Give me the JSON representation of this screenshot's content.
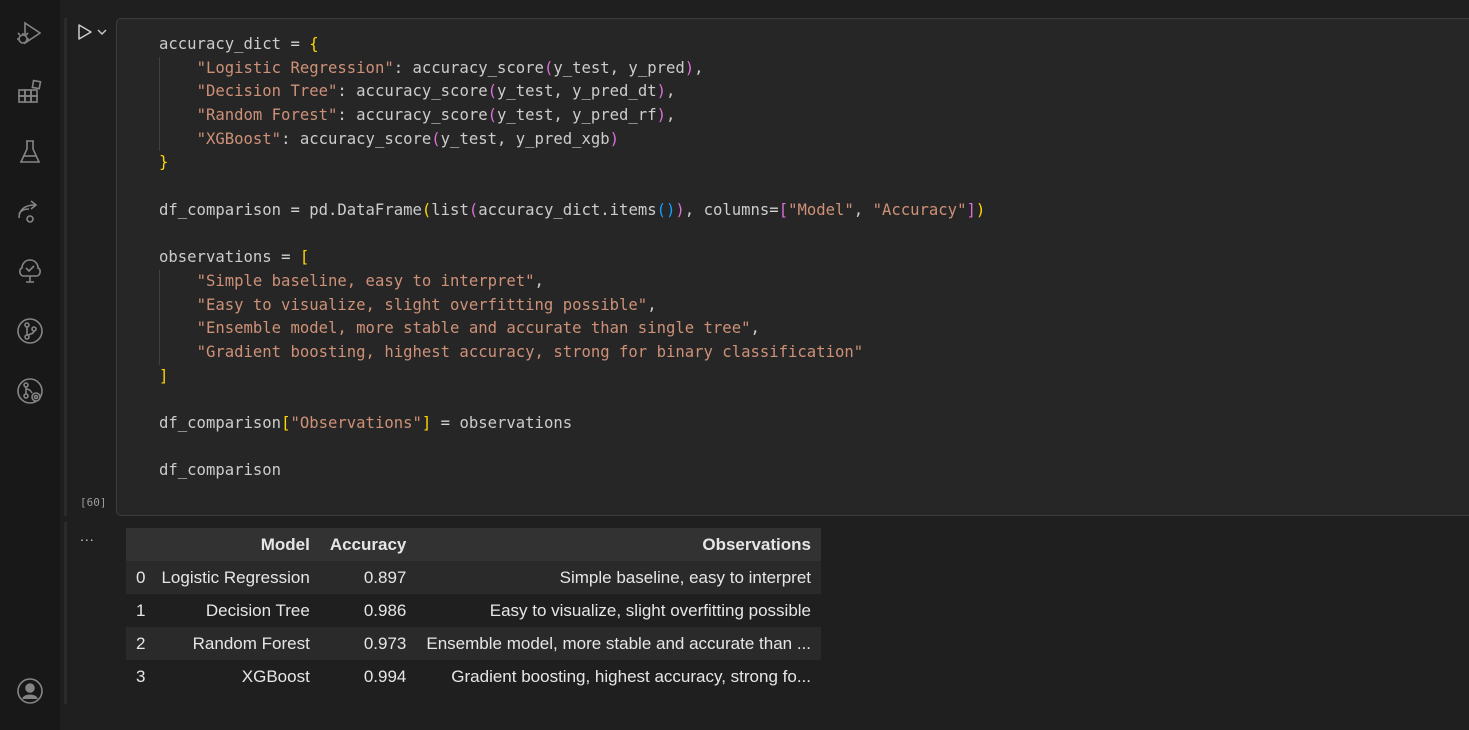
{
  "activity_bar": {
    "icons": [
      "run-debug-icon",
      "extensions-icon",
      "testing-icon",
      "remote-explorer-icon",
      "tree-check-icon",
      "source-control-icon",
      "git-graph-icon",
      "account-icon"
    ]
  },
  "cell": {
    "execution_count": "[60]",
    "code_lines": [
      "accuracy_dict = {",
      "    \"Logistic Regression\": accuracy_score(y_test, y_pred),",
      "    \"Decision Tree\": accuracy_score(y_test, y_pred_dt),",
      "    \"Random Forest\": accuracy_score(y_test, y_pred_rf),",
      "    \"XGBoost\": accuracy_score(y_test, y_pred_xgb)",
      "}",
      "",
      "df_comparison = pd.DataFrame(list(accuracy_dict.items()), columns=[\"Model\", \"Accuracy\"])",
      "",
      "observations = [",
      "    \"Simple baseline, easy to interpret\",",
      "    \"Easy to visualize, slight overfitting possible\",",
      "    \"Ensemble model, more stable and accurate than single tree\",",
      "    \"Gradient boosting, highest accuracy, strong for binary classification\"",
      "]",
      "",
      "df_comparison[\"Observations\"] = observations",
      "",
      "df_comparison"
    ]
  },
  "output": {
    "more_label": "...",
    "table": {
      "columns": [
        "",
        "Model",
        "Accuracy",
        "Observations"
      ],
      "rows": [
        {
          "index": "0",
          "model": "Logistic Regression",
          "accuracy": "0.897",
          "observations": "Simple baseline, easy to interpret"
        },
        {
          "index": "1",
          "model": "Decision Tree",
          "accuracy": "0.986",
          "observations": "Easy to visualize, slight overfitting possible"
        },
        {
          "index": "2",
          "model": "Random Forest",
          "accuracy": "0.973",
          "observations": "Ensemble model, more stable and accurate than ..."
        },
        {
          "index": "3",
          "model": "XGBoost",
          "accuracy": "0.994",
          "observations": "Gradient boosting, highest accuracy, strong fo..."
        }
      ]
    }
  },
  "colors": {
    "background": "#1f1f1f",
    "activity_bar": "#181818",
    "string": "#ce9178",
    "bracket_level1": "#ffd700",
    "bracket_level2": "#da70d6",
    "bracket_level3": "#179fff"
  }
}
